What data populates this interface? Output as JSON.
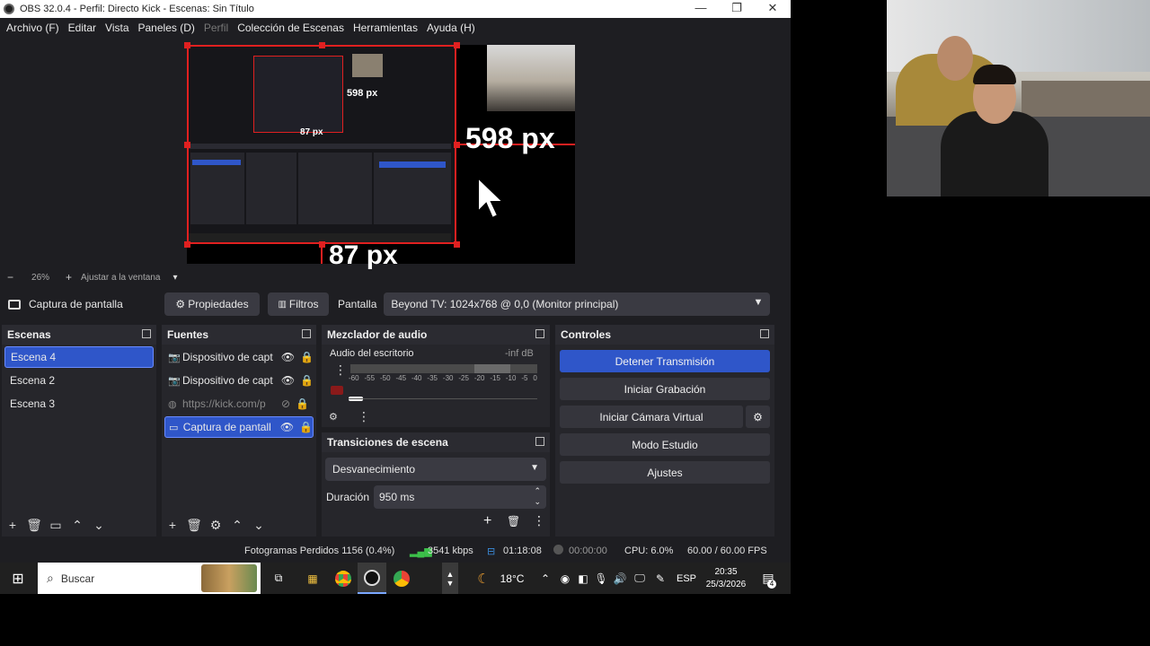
{
  "window": {
    "title": "OBS 32.0.4 - Perfil: Directo Kick - Escenas: Sin Título",
    "minimize": "—",
    "maximize": "❐",
    "close": "✕"
  },
  "menu": [
    "Archivo (F)",
    "Editar",
    "Vista",
    "Paneles (D)",
    "Perfil",
    "Colección de Escenas",
    "Herramientas",
    "Ayuda (H)"
  ],
  "preview": {
    "overlay_width_label": "598 px",
    "overlay_height_label": "87 px",
    "inner_width_label": "598 px",
    "inner_height_label": "87 px",
    "zoom": "26%",
    "fit_label": "Ajustar a la ventana"
  },
  "source_toolbar": {
    "source_name": "Captura de pantalla",
    "properties": "Propiedades",
    "filters": "Filtros",
    "screen_label": "Pantalla",
    "screen_value": "Beyond TV: 1024x768 @ 0,0 (Monitor principal)"
  },
  "scenes": {
    "title": "Escenas",
    "items": [
      "Escena 4",
      "Escena 2",
      "Escena 3"
    ],
    "selected": 0
  },
  "sources": {
    "title": "Fuentes",
    "items": [
      "Dispositivo de capt",
      "Dispositivo de capt",
      "https://kick.com/p",
      "Captura de pantall"
    ]
  },
  "mixer": {
    "title": "Mezclador de audio",
    "track_name": "Audio del escritorio",
    "level": "-inf dB",
    "scale": [
      "-60",
      "-55",
      "-50",
      "-45",
      "-40",
      "-35",
      "-30",
      "-25",
      "-20",
      "-15",
      "-10",
      "-5",
      "0"
    ]
  },
  "transitions": {
    "title": "Transiciones de escena",
    "selected": "Desvanecimiento",
    "duration_label": "Duración",
    "duration_value": "950 ms"
  },
  "controls": {
    "title": "Controles",
    "stop_stream": "Detener Transmisión",
    "start_record": "Iniciar Grabación",
    "virtual_cam": "Iniciar Cámara Virtual",
    "studio_mode": "Modo Estudio",
    "settings": "Ajustes"
  },
  "status": {
    "dropped_frames": "Fotogramas Perdidos 1156 (0.4%)",
    "bitrate": "3541 kbps",
    "stream_time": "01:18:08",
    "record_time": "00:00:00",
    "cpu": "CPU: 6.0%",
    "fps": "60.00 / 60.00 FPS"
  },
  "taskbar": {
    "search": "Buscar",
    "weather": "18°C",
    "lang": "ESP",
    "time": "20:35",
    "date": "25/3/2026",
    "notif_count": "4"
  },
  "colors": {
    "accent": "#2f56c9",
    "selection_red": "#e02020",
    "bg": "#1e1e22"
  }
}
